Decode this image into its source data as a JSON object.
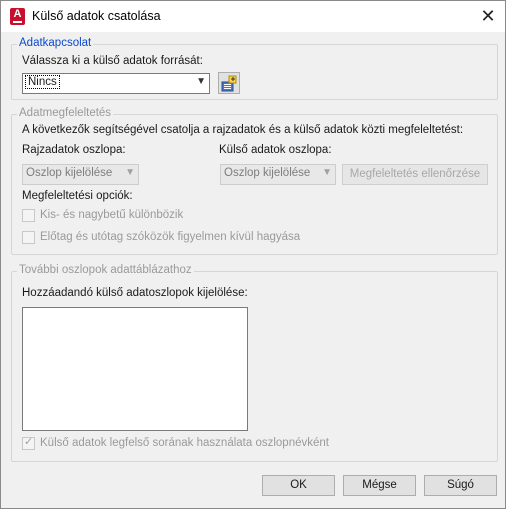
{
  "window": {
    "title": "Külső adatok csatolása",
    "close_glyph": "✕"
  },
  "connection": {
    "group_label": "Adatkapcsolat",
    "source_label": "Válassza ki a külső adatok forrását:",
    "source_value": "Nincs",
    "browse_icon": "data-source-manager-icon"
  },
  "mapping": {
    "group_label": "Adatmegfeleltetés",
    "description": "A következők segítségével csatolja a rajzadatok és a külső adatok közti megfeleltetést:",
    "drawing_column_label": "Rajzadatok oszlopa:",
    "drawing_column_value": "Oszlop kijelölése",
    "external_column_label": "Külső adatok oszlopa:",
    "external_column_value": "Oszlop kijelölése",
    "check_button": "Megfeleltetés ellenőrzése",
    "options_label": "Megfeleltetési opciók:",
    "case_option": "Kis- és nagybetű különbözik",
    "whitespace_option": "Előtag és utótag szóközök figyelmen kívül hagyása"
  },
  "extra": {
    "group_label": "További oszlopok adattáblázathoz",
    "list_label": "Hozzáadandó külső adatoszlopok kijelölése:",
    "first_row_option": "Külső adatok legfelső sorának használata oszlopnévként"
  },
  "buttons": {
    "ok": "OK",
    "cancel": "Mégse",
    "help": "Súgó"
  },
  "colors": {
    "accent_blue": "#0a4bd0",
    "app_red": "#c8102e"
  }
}
